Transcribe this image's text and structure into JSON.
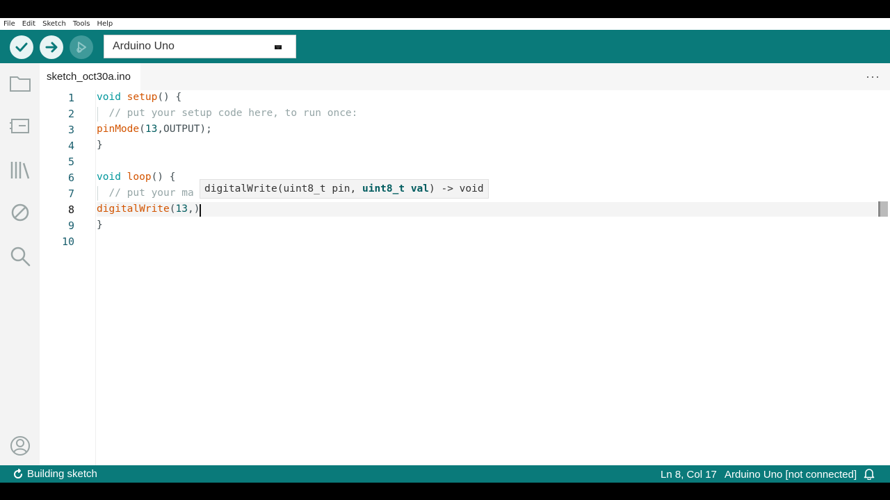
{
  "menu": [
    "File",
    "Edit",
    "Sketch",
    "Tools",
    "Help"
  ],
  "toolbar": {
    "board": "Arduino Uno"
  },
  "tab": {
    "filename": "sketch_oct30a.ino",
    "more": "···"
  },
  "editor": {
    "line_numbers": [
      "1",
      "2",
      "3",
      "4",
      "5",
      "6",
      "7",
      "8",
      "9",
      "10"
    ],
    "current_line": "8"
  },
  "tooltip": {
    "signature_prefix": "digitalWrite(uint8_t pin, ",
    "active_param": "uint8_t val",
    "signature_suffix": ") -> void"
  },
  "status": {
    "task": "Building sketch",
    "position": "Ln 8, Col 17",
    "board_status": "Arduino Uno [not connected]"
  },
  "colors": {
    "accent": "#0a7a7a",
    "keyword": "#00979c",
    "function": "#d35400",
    "comment": "#95a5a6"
  }
}
